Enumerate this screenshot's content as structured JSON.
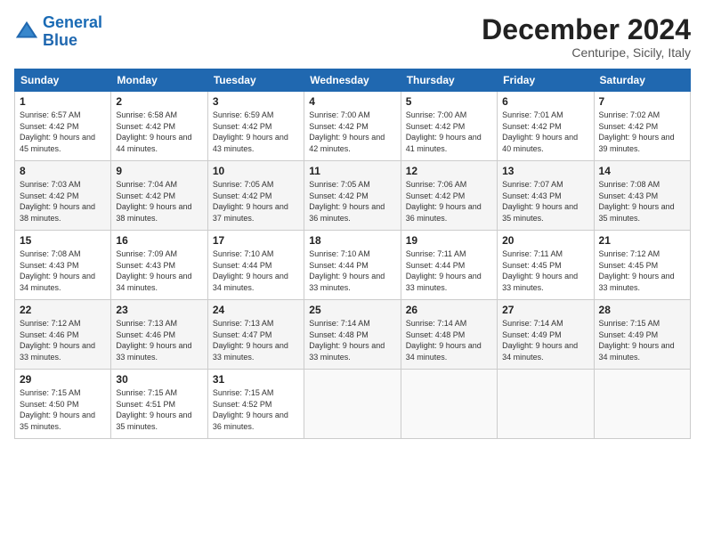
{
  "header": {
    "logo_line1": "General",
    "logo_line2": "Blue",
    "main_title": "December 2024",
    "subtitle": "Centuripe, Sicily, Italy"
  },
  "days_of_week": [
    "Sunday",
    "Monday",
    "Tuesday",
    "Wednesday",
    "Thursday",
    "Friday",
    "Saturday"
  ],
  "weeks": [
    [
      {
        "day": "1",
        "sunrise": "Sunrise: 6:57 AM",
        "sunset": "Sunset: 4:42 PM",
        "daylight": "Daylight: 9 hours and 45 minutes."
      },
      {
        "day": "2",
        "sunrise": "Sunrise: 6:58 AM",
        "sunset": "Sunset: 4:42 PM",
        "daylight": "Daylight: 9 hours and 44 minutes."
      },
      {
        "day": "3",
        "sunrise": "Sunrise: 6:59 AM",
        "sunset": "Sunset: 4:42 PM",
        "daylight": "Daylight: 9 hours and 43 minutes."
      },
      {
        "day": "4",
        "sunrise": "Sunrise: 7:00 AM",
        "sunset": "Sunset: 4:42 PM",
        "daylight": "Daylight: 9 hours and 42 minutes."
      },
      {
        "day": "5",
        "sunrise": "Sunrise: 7:00 AM",
        "sunset": "Sunset: 4:42 PM",
        "daylight": "Daylight: 9 hours and 41 minutes."
      },
      {
        "day": "6",
        "sunrise": "Sunrise: 7:01 AM",
        "sunset": "Sunset: 4:42 PM",
        "daylight": "Daylight: 9 hours and 40 minutes."
      },
      {
        "day": "7",
        "sunrise": "Sunrise: 7:02 AM",
        "sunset": "Sunset: 4:42 PM",
        "daylight": "Daylight: 9 hours and 39 minutes."
      }
    ],
    [
      {
        "day": "8",
        "sunrise": "Sunrise: 7:03 AM",
        "sunset": "Sunset: 4:42 PM",
        "daylight": "Daylight: 9 hours and 38 minutes."
      },
      {
        "day": "9",
        "sunrise": "Sunrise: 7:04 AM",
        "sunset": "Sunset: 4:42 PM",
        "daylight": "Daylight: 9 hours and 38 minutes."
      },
      {
        "day": "10",
        "sunrise": "Sunrise: 7:05 AM",
        "sunset": "Sunset: 4:42 PM",
        "daylight": "Daylight: 9 hours and 37 minutes."
      },
      {
        "day": "11",
        "sunrise": "Sunrise: 7:05 AM",
        "sunset": "Sunset: 4:42 PM",
        "daylight": "Daylight: 9 hours and 36 minutes."
      },
      {
        "day": "12",
        "sunrise": "Sunrise: 7:06 AM",
        "sunset": "Sunset: 4:42 PM",
        "daylight": "Daylight: 9 hours and 36 minutes."
      },
      {
        "day": "13",
        "sunrise": "Sunrise: 7:07 AM",
        "sunset": "Sunset: 4:43 PM",
        "daylight": "Daylight: 9 hours and 35 minutes."
      },
      {
        "day": "14",
        "sunrise": "Sunrise: 7:08 AM",
        "sunset": "Sunset: 4:43 PM",
        "daylight": "Daylight: 9 hours and 35 minutes."
      }
    ],
    [
      {
        "day": "15",
        "sunrise": "Sunrise: 7:08 AM",
        "sunset": "Sunset: 4:43 PM",
        "daylight": "Daylight: 9 hours and 34 minutes."
      },
      {
        "day": "16",
        "sunrise": "Sunrise: 7:09 AM",
        "sunset": "Sunset: 4:43 PM",
        "daylight": "Daylight: 9 hours and 34 minutes."
      },
      {
        "day": "17",
        "sunrise": "Sunrise: 7:10 AM",
        "sunset": "Sunset: 4:44 PM",
        "daylight": "Daylight: 9 hours and 34 minutes."
      },
      {
        "day": "18",
        "sunrise": "Sunrise: 7:10 AM",
        "sunset": "Sunset: 4:44 PM",
        "daylight": "Daylight: 9 hours and 33 minutes."
      },
      {
        "day": "19",
        "sunrise": "Sunrise: 7:11 AM",
        "sunset": "Sunset: 4:44 PM",
        "daylight": "Daylight: 9 hours and 33 minutes."
      },
      {
        "day": "20",
        "sunrise": "Sunrise: 7:11 AM",
        "sunset": "Sunset: 4:45 PM",
        "daylight": "Daylight: 9 hours and 33 minutes."
      },
      {
        "day": "21",
        "sunrise": "Sunrise: 7:12 AM",
        "sunset": "Sunset: 4:45 PM",
        "daylight": "Daylight: 9 hours and 33 minutes."
      }
    ],
    [
      {
        "day": "22",
        "sunrise": "Sunrise: 7:12 AM",
        "sunset": "Sunset: 4:46 PM",
        "daylight": "Daylight: 9 hours and 33 minutes."
      },
      {
        "day": "23",
        "sunrise": "Sunrise: 7:13 AM",
        "sunset": "Sunset: 4:46 PM",
        "daylight": "Daylight: 9 hours and 33 minutes."
      },
      {
        "day": "24",
        "sunrise": "Sunrise: 7:13 AM",
        "sunset": "Sunset: 4:47 PM",
        "daylight": "Daylight: 9 hours and 33 minutes."
      },
      {
        "day": "25",
        "sunrise": "Sunrise: 7:14 AM",
        "sunset": "Sunset: 4:48 PM",
        "daylight": "Daylight: 9 hours and 33 minutes."
      },
      {
        "day": "26",
        "sunrise": "Sunrise: 7:14 AM",
        "sunset": "Sunset: 4:48 PM",
        "daylight": "Daylight: 9 hours and 34 minutes."
      },
      {
        "day": "27",
        "sunrise": "Sunrise: 7:14 AM",
        "sunset": "Sunset: 4:49 PM",
        "daylight": "Daylight: 9 hours and 34 minutes."
      },
      {
        "day": "28",
        "sunrise": "Sunrise: 7:15 AM",
        "sunset": "Sunset: 4:49 PM",
        "daylight": "Daylight: 9 hours and 34 minutes."
      }
    ],
    [
      {
        "day": "29",
        "sunrise": "Sunrise: 7:15 AM",
        "sunset": "Sunset: 4:50 PM",
        "daylight": "Daylight: 9 hours and 35 minutes."
      },
      {
        "day": "30",
        "sunrise": "Sunrise: 7:15 AM",
        "sunset": "Sunset: 4:51 PM",
        "daylight": "Daylight: 9 hours and 35 minutes."
      },
      {
        "day": "31",
        "sunrise": "Sunrise: 7:15 AM",
        "sunset": "Sunset: 4:52 PM",
        "daylight": "Daylight: 9 hours and 36 minutes."
      },
      null,
      null,
      null,
      null
    ]
  ]
}
